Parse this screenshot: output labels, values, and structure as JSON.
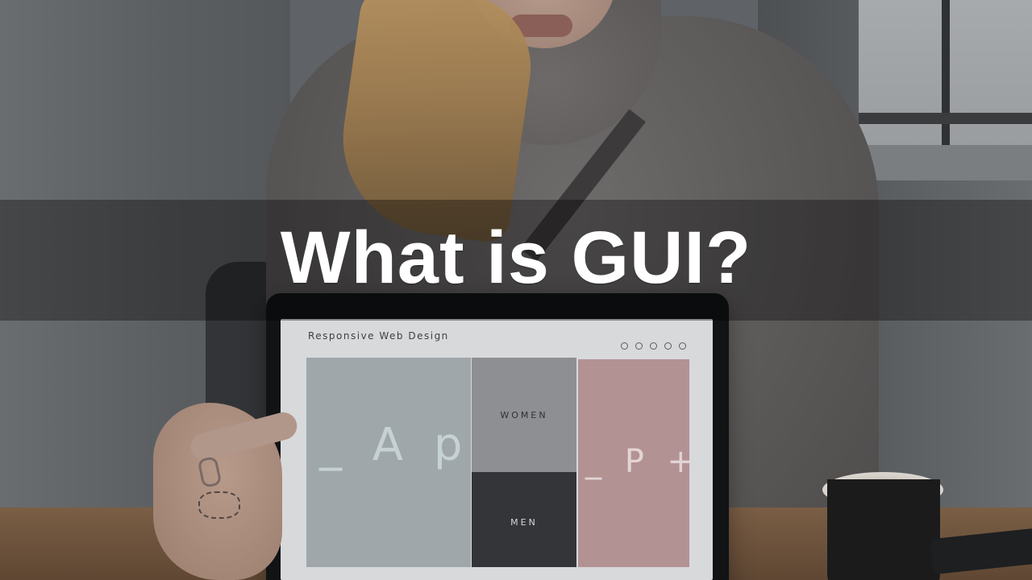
{
  "headline": "What is GUI?",
  "laptop_ui": {
    "title": "Responsive Web Design",
    "left_panel_text": "_ A p",
    "women_label": "WOMEN",
    "men_label": "MEN",
    "right_panel_text": "_ P +",
    "nav_dots": [
      "dot-1",
      "dot-2",
      "dot-3",
      "dot-4",
      "dot-5"
    ]
  }
}
